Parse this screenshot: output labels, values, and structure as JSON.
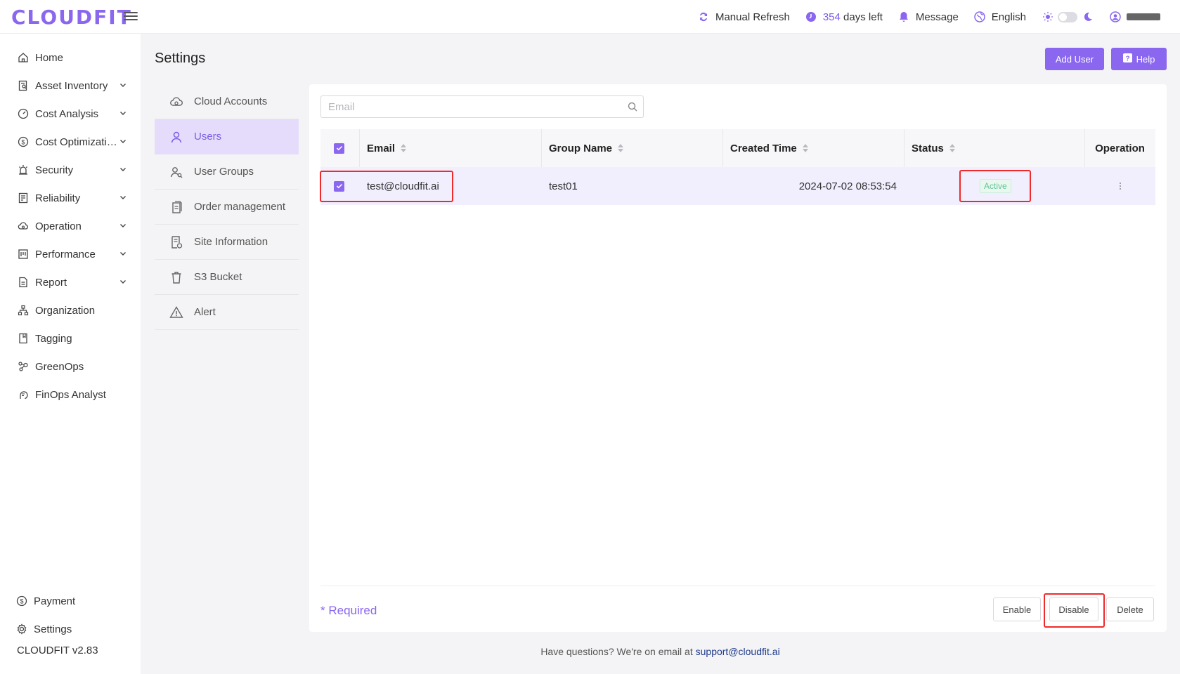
{
  "app": {
    "logo": "CLOUDFIT",
    "brand_color": "#8a67ee"
  },
  "topbar": {
    "refresh_label": "Manual Refresh",
    "days_num": "354",
    "days_label": "days left",
    "message_label": "Message",
    "language_label": "English",
    "theme_toggle": "off"
  },
  "sidebar": {
    "items": [
      {
        "label": "Home",
        "icon": "home-icon"
      },
      {
        "label": "Asset Inventory",
        "icon": "asset-icon"
      },
      {
        "label": "Cost Analysis",
        "icon": "gauge-icon"
      },
      {
        "label": "Cost Optimizati…",
        "icon": "dollar-icon"
      },
      {
        "label": "Security",
        "icon": "alarm-icon"
      },
      {
        "label": "Reliability",
        "icon": "doc-icon"
      },
      {
        "label": "Operation",
        "icon": "cloud-icon"
      },
      {
        "label": "Performance",
        "icon": "chart-icon"
      },
      {
        "label": "Report",
        "icon": "report-icon"
      },
      {
        "label": "Organization",
        "icon": "org-icon"
      },
      {
        "label": "Tagging",
        "icon": "tag-icon"
      },
      {
        "label": "GreenOps",
        "icon": "leaf-icon"
      },
      {
        "label": "FinOps Analyst",
        "icon": "analyst-icon"
      }
    ],
    "payment": "Payment",
    "settings": "Settings",
    "version": "CLOUDFIT v2.83"
  },
  "page": {
    "title": "Settings",
    "add_user": "Add User",
    "help": "Help"
  },
  "settings_menu": [
    {
      "label": "Cloud Accounts"
    },
    {
      "label": "Users"
    },
    {
      "label": "User Groups"
    },
    {
      "label": "Order management"
    },
    {
      "label": "Site Information"
    },
    {
      "label": "S3 Bucket"
    },
    {
      "label": "Alert"
    }
  ],
  "search": {
    "placeholder": "Email"
  },
  "table": {
    "headers": {
      "email": "Email",
      "group": "Group Name",
      "created": "Created Time",
      "status": "Status",
      "operation": "Operation"
    },
    "rows": [
      {
        "email": "test@cloudfit.ai",
        "group": "test01",
        "created": "2024-07-02 08:53:54",
        "status": "Active"
      }
    ]
  },
  "footer": {
    "required": "* Required",
    "enable": "Enable",
    "disable": "Disable",
    "delete": "Delete"
  },
  "bottom_note": {
    "text": "Have questions? We're on email at ",
    "email": "support@cloudfit.ai"
  }
}
